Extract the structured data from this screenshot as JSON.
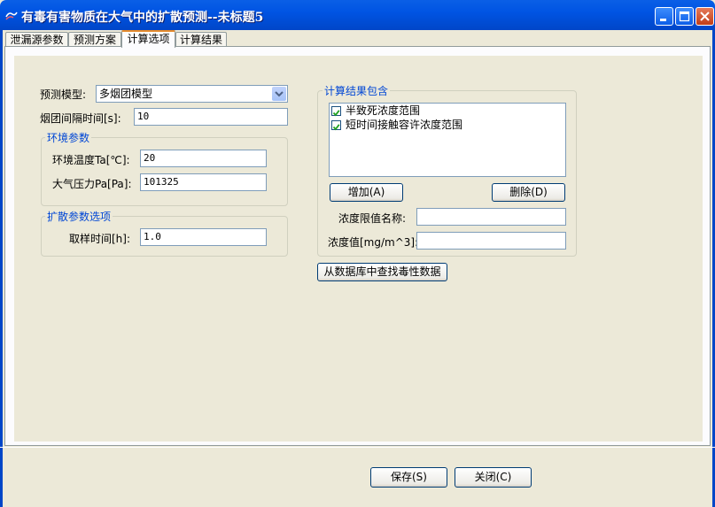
{
  "window": {
    "title": "有毒有害物质在大气中的扩散预测--未标题5"
  },
  "tabs": [
    {
      "label": "泄漏源参数",
      "active": false
    },
    {
      "label": "预测方案",
      "active": false
    },
    {
      "label": "计算选项",
      "active": true
    },
    {
      "label": "计算结果",
      "active": false
    }
  ],
  "form": {
    "model_label": "预测模型:",
    "model_value": "多烟团模型",
    "interval_label": "烟团间隔时间[s]:",
    "interval_value": "10"
  },
  "env_group": {
    "title": "环境参数",
    "temp_label": "环境温度Ta[℃]:",
    "temp_value": "20",
    "pressure_label": "大气压力Pa[Pa]:",
    "pressure_value": "101325"
  },
  "diffusion_group": {
    "title": "扩散参数选项",
    "sample_label": "取样时间[h]:",
    "sample_value": "1.0"
  },
  "results_group": {
    "title": "计算结果包含",
    "items": [
      {
        "label": "半致死浓度范围",
        "checked": true
      },
      {
        "label": "短时间接触容许浓度范围",
        "checked": true
      }
    ],
    "add_button": "增加(A)",
    "delete_button": "删除(D)",
    "limit_name_label": "浓度限值名称:",
    "limit_name_value": "",
    "concentration_label": "浓度值[mg/m^3]:",
    "concentration_value": ""
  },
  "db_button": "从数据库中查找毒性数据",
  "footer": {
    "save": "保存(S)",
    "close": "关闭(C)"
  },
  "colors": {
    "titlebar": "#0054e3",
    "face": "#ece9d8",
    "group_title": "#0046d5",
    "tab_highlight": "#e68b2c"
  }
}
